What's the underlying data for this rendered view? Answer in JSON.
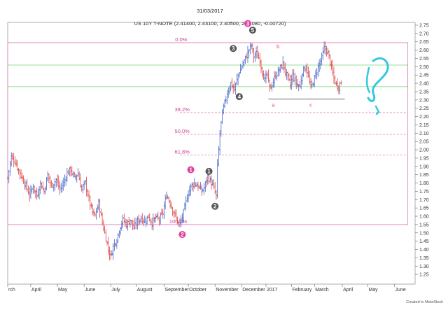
{
  "page_date": "31/03/2017",
  "footer_credit": "Created in MetaStock",
  "chart_data": {
    "type": "ohlc",
    "title": "US 10Y T-NOTE (2.41400, 2.43100, 2.40500, 2.41080, -0.00720)",
    "ylim": [
      1.2,
      2.75
    ],
    "y_ticks": [
      1.25,
      1.3,
      1.35,
      1.4,
      1.45,
      1.5,
      1.55,
      1.6,
      1.65,
      1.7,
      1.75,
      1.8,
      1.85,
      1.9,
      1.95,
      2.0,
      2.05,
      2.1,
      2.15,
      2.2,
      2.25,
      2.3,
      2.35,
      2.4,
      2.45,
      2.5,
      2.55,
      2.6,
      2.65,
      2.7,
      2.75
    ],
    "x_ticks": [
      {
        "label": "rch",
        "t": 0
      },
      {
        "label": "April",
        "t": 19
      },
      {
        "label": "May",
        "t": 41
      },
      {
        "label": "June",
        "t": 63
      },
      {
        "label": "July",
        "t": 85
      },
      {
        "label": "August",
        "t": 106
      },
      {
        "label": "September",
        "t": 129
      },
      {
        "label": "October",
        "t": 149
      },
      {
        "label": "November",
        "t": 171
      },
      {
        "label": "December",
        "t": 193
      },
      {
        "label": "2017",
        "t": 213
      },
      {
        "label": "February",
        "t": 234
      },
      {
        "label": "March",
        "t": 253
      },
      {
        "label": "April",
        "t": 276
      },
      {
        "label": "May",
        "t": 297
      },
      {
        "label": "June",
        "t": 319
      }
    ],
    "t_range": [
      0,
      336
    ],
    "anchors": [
      [
        0,
        1.83
      ],
      [
        3,
        1.96
      ],
      [
        6,
        1.93
      ],
      [
        10,
        1.86
      ],
      [
        14,
        1.8
      ],
      [
        18,
        1.73
      ],
      [
        21,
        1.78
      ],
      [
        24,
        1.72
      ],
      [
        27,
        1.8
      ],
      [
        30,
        1.75
      ],
      [
        33,
        1.85
      ],
      [
        36,
        1.78
      ],
      [
        40,
        1.82
      ],
      [
        43,
        1.76
      ],
      [
        46,
        1.8
      ],
      [
        49,
        1.86
      ],
      [
        52,
        1.88
      ],
      [
        55,
        1.83
      ],
      [
        58,
        1.86
      ],
      [
        61,
        1.76
      ],
      [
        64,
        1.8
      ],
      [
        67,
        1.7
      ],
      [
        70,
        1.62
      ],
      [
        72,
        1.6
      ],
      [
        75,
        1.68
      ],
      [
        78,
        1.56
      ],
      [
        81,
        1.47
      ],
      [
        83,
        1.4
      ],
      [
        85,
        1.36
      ],
      [
        87,
        1.42
      ],
      [
        90,
        1.46
      ],
      [
        92,
        1.52
      ],
      [
        95,
        1.58
      ],
      [
        98,
        1.55
      ],
      [
        101,
        1.58
      ],
      [
        104,
        1.53
      ],
      [
        107,
        1.57
      ],
      [
        110,
        1.59
      ],
      [
        113,
        1.57
      ],
      [
        116,
        1.6
      ],
      [
        119,
        1.56
      ],
      [
        122,
        1.59
      ],
      [
        125,
        1.58
      ],
      [
        128,
        1.62
      ],
      [
        131,
        1.73
      ],
      [
        134,
        1.68
      ],
      [
        137,
        1.62
      ],
      [
        140,
        1.57
      ],
      [
        142,
        1.55
      ],
      [
        145,
        1.62
      ],
      [
        148,
        1.72
      ],
      [
        151,
        1.78
      ],
      [
        154,
        1.8
      ],
      [
        157,
        1.78
      ],
      [
        160,
        1.75
      ],
      [
        162,
        1.77
      ],
      [
        165,
        1.84
      ],
      [
        168,
        1.8
      ],
      [
        170,
        1.77
      ],
      [
        172,
        1.72
      ],
      [
        173,
        1.9
      ],
      [
        175,
        2.1
      ],
      [
        177,
        2.22
      ],
      [
        179,
        2.28
      ],
      [
        181,
        2.34
      ],
      [
        184,
        2.4
      ],
      [
        187,
        2.36
      ],
      [
        190,
        2.45
      ],
      [
        193,
        2.5
      ],
      [
        196,
        2.55
      ],
      [
        199,
        2.6
      ],
      [
        201,
        2.63
      ],
      [
        203,
        2.56
      ],
      [
        205,
        2.58
      ],
      [
        208,
        2.54
      ],
      [
        210,
        2.47
      ],
      [
        212,
        2.42
      ],
      [
        214,
        2.45
      ],
      [
        216,
        2.37
      ],
      [
        218,
        2.39
      ],
      [
        221,
        2.45
      ],
      [
        224,
        2.48
      ],
      [
        227,
        2.52
      ],
      [
        229,
        2.47
      ],
      [
        231,
        2.43
      ],
      [
        233,
        2.39
      ],
      [
        235,
        2.45
      ],
      [
        238,
        2.4
      ],
      [
        241,
        2.38
      ],
      [
        243,
        2.47
      ],
      [
        246,
        2.5
      ],
      [
        248,
        2.44
      ],
      [
        250,
        2.37
      ],
      [
        253,
        2.43
      ],
      [
        256,
        2.5
      ],
      [
        259,
        2.55
      ],
      [
        261,
        2.61
      ],
      [
        263,
        2.6
      ],
      [
        265,
        2.56
      ],
      [
        267,
        2.49
      ],
      [
        269,
        2.43
      ],
      [
        271,
        2.39
      ],
      [
        273,
        2.38
      ],
      [
        275,
        2.41
      ]
    ],
    "fib_levels": [
      {
        "label": "0.0%",
        "value": 2.645
      },
      {
        "label": "38.2%",
        "value": 2.224
      },
      {
        "label": "50.0%",
        "value": 2.093
      },
      {
        "label": "61.8%",
        "value": 1.968
      },
      {
        "label": "100.0%",
        "value": 1.55
      }
    ],
    "boxes": [
      {
        "t0": 0,
        "t1": 330,
        "top": 2.51,
        "bottom": 2.38,
        "color": "#7ed87e"
      },
      {
        "t0": 0,
        "t1": 330,
        "top": 2.645,
        "bottom": 1.55,
        "color": "#e07fbe"
      }
    ],
    "support_line": {
      "t0": 215,
      "t1": 278,
      "value": 2.305
    },
    "wave_markers": [
      {
        "label": "1",
        "t": 151,
        "y": 1.88,
        "fill": "#e040a0",
        "style": "circle"
      },
      {
        "label": "2",
        "t": 144,
        "y": 1.49,
        "fill": "#e040a0",
        "style": "circle"
      },
      {
        "label": "3",
        "t": 198,
        "y": 2.76,
        "fill": "#e040a0",
        "style": "circle"
      },
      {
        "label": "1",
        "t": 166,
        "y": 1.87,
        "fill": "#555555",
        "style": "circle"
      },
      {
        "label": "2",
        "t": 171,
        "y": 1.66,
        "fill": "#555555",
        "style": "circle"
      },
      {
        "label": "3",
        "t": 186,
        "y": 2.61,
        "fill": "#555555",
        "style": "circle"
      },
      {
        "label": "4",
        "t": 191,
        "y": 2.32,
        "fill": "#555555",
        "style": "circle"
      },
      {
        "label": "5",
        "t": 202,
        "y": 2.72,
        "fill": "#555555",
        "style": "circle"
      },
      {
        "label": "b",
        "t": 223,
        "y": 2.61,
        "fill": "#e05050",
        "style": "text"
      },
      {
        "label": "a",
        "t": 219,
        "y": 2.26,
        "fill": "#e05050",
        "style": "text"
      },
      {
        "label": "c",
        "t": 250,
        "y": 2.26,
        "fill": "#e05050",
        "style": "text"
      }
    ],
    "annotations": [
      {
        "label": "?",
        "color": "#37c8e0"
      }
    ],
    "bar_up_color": "#4466cc",
    "bar_down_color": "#dd4444"
  }
}
